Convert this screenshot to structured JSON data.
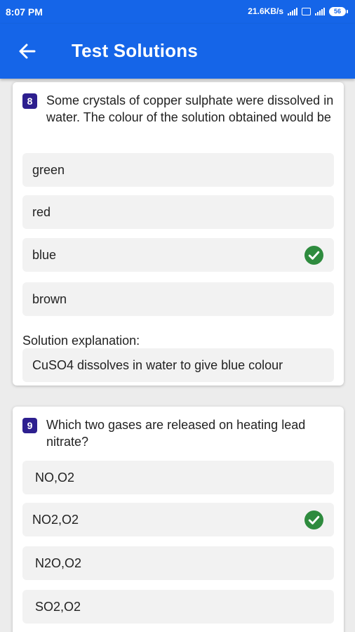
{
  "status_bar": {
    "time": "8:07 PM",
    "net_speed": "21.6KB/s",
    "battery": "56"
  },
  "app_bar": {
    "title": "Test Solutions",
    "back_icon": "arrow-left-icon"
  },
  "questions": [
    {
      "number": "8",
      "text": "Some crystals of copper sulphate were dissolved in water. The colour of the solution obtained would be",
      "options": [
        {
          "label": "green",
          "correct": false
        },
        {
          "label": "red",
          "correct": false
        },
        {
          "label": "blue",
          "correct": true
        },
        {
          "label": "brown",
          "correct": false
        }
      ],
      "solution_title": "Solution explanation:",
      "solution_text": "CuSO4 dissolves in water to give blue colour"
    },
    {
      "number": "9",
      "text": "Which two gases are released on heating lead nitrate?",
      "options": [
        {
          "label": "NO,O2",
          "correct": false
        },
        {
          "label": "NO2,O2",
          "correct": true
        },
        {
          "label": "N2O,O2",
          "correct": false
        },
        {
          "label": "SO2,O2",
          "correct": false
        }
      ]
    }
  ],
  "colors": {
    "primary": "#1565e8",
    "badge": "#2d1f8f",
    "correct": "#2e8b3e"
  }
}
